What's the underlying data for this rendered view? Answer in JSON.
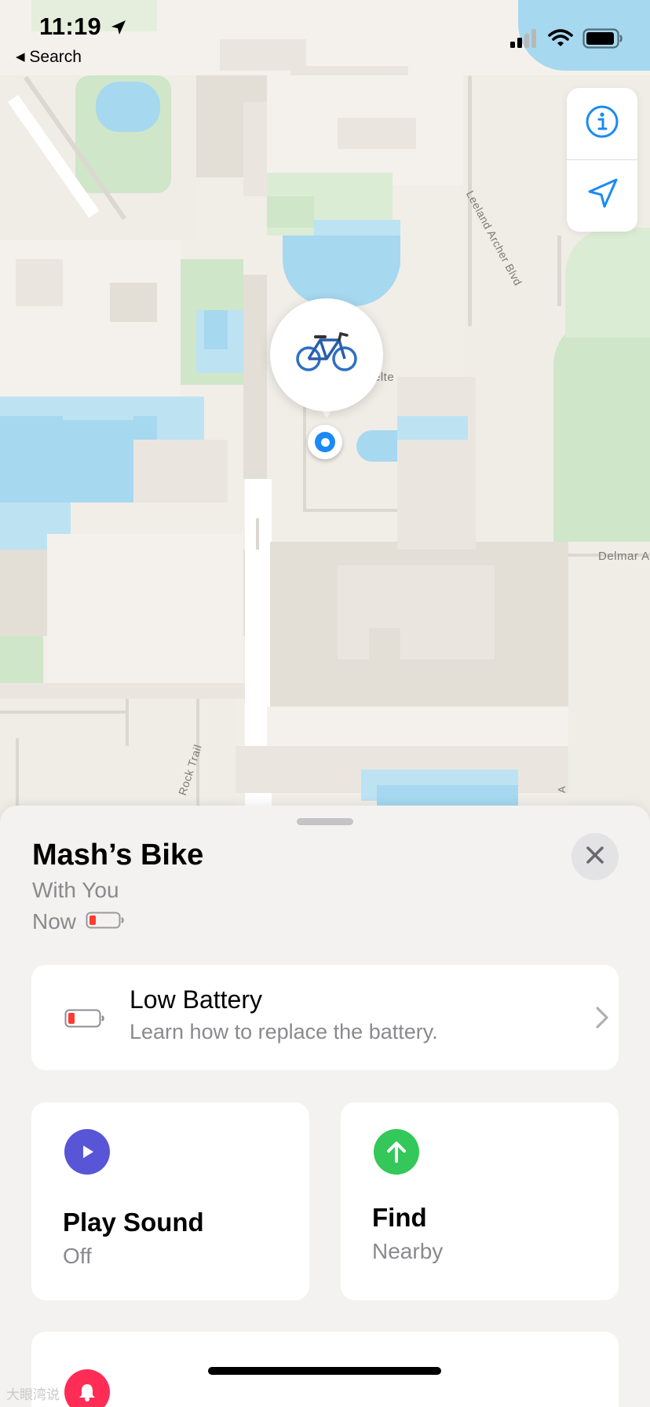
{
  "status_bar": {
    "time": "11:19",
    "back_label": "Search",
    "location_icon": "location-arrow-icon",
    "signal_icon": "cellular-signal-icon",
    "wifi_icon": "wifi-icon",
    "battery_icon": "battery-icon"
  },
  "map": {
    "labels": {
      "street_1": "Leeland Archer Blvd",
      "street_2": "Delmar A",
      "street_3": "Rock Trail",
      "street_4": "elte",
      "street_5": "A"
    },
    "controls": {
      "info_icon": "info-icon",
      "locate_icon": "location-arrow-icon"
    },
    "pin": {
      "emoji": "🚲",
      "icon": "bicycle-icon"
    },
    "colors": {
      "water": "#a6d8f0",
      "park": "#cfe6c8",
      "land": "#f1eee8"
    }
  },
  "sheet": {
    "title": "Mash’s Bike",
    "subtitle": "With You",
    "time_label": "Now",
    "battery_status": "low",
    "close_icon": "close-icon",
    "low_battery": {
      "title": "Low Battery",
      "subtitle": "Learn how to replace the battery.",
      "icon": "battery-low-icon",
      "chevron_icon": "chevron-right-icon"
    },
    "play_sound": {
      "title": "Play Sound",
      "subtitle": "Off",
      "icon": "play-icon",
      "color": "#5856d6"
    },
    "find": {
      "title": "Find",
      "subtitle": "Nearby",
      "icon": "arrow-up-icon",
      "color": "#34c759"
    },
    "notify": {
      "icon": "bell-icon",
      "color": "#ff2d55"
    }
  },
  "colors": {
    "accent_blue": "#1a8af5",
    "battery_red": "#ff3b30"
  },
  "watermark": "大眼湾说"
}
